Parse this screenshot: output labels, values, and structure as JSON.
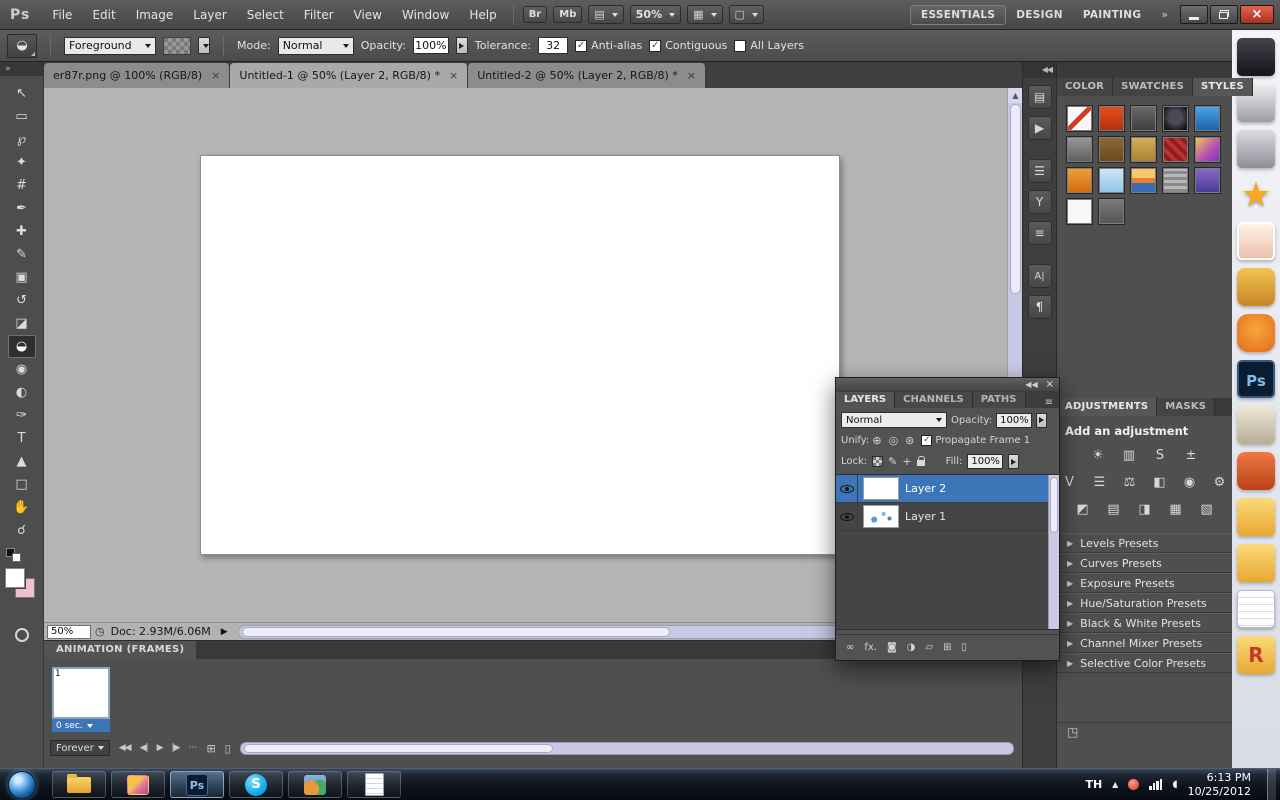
{
  "colors": {
    "selection_blue": "#3c76b9",
    "close_red": "#b03222",
    "scrollbar_lavender": "#c9c9e6",
    "canvas_gray": "#b5b5b5"
  },
  "menubar": {
    "logo": "Ps",
    "menus": [
      "File",
      "Edit",
      "Image",
      "Layer",
      "Select",
      "Filter",
      "View",
      "Window",
      "Help"
    ],
    "bridge": "Br",
    "mini_bridge": "Mb",
    "zoom": "50%",
    "view_extras_glyph": "▤",
    "arrange_glyph": "▦",
    "screen_mode_glyph": "▢",
    "workspaces": [
      "ESSENTIALS",
      "DESIGN",
      "PAINTING"
    ],
    "overflow": "»"
  },
  "options": {
    "tool_glyph": "◒",
    "fill": "Foreground",
    "mode_label": "Mode:",
    "mode": "Normal",
    "opacity_label": "Opacity:",
    "opacity": "100%",
    "tolerance_label": "Tolerance:",
    "tolerance": "32",
    "check": "✓",
    "anti_alias": "Anti-alias",
    "contiguous": "Contiguous",
    "all_layers": "All Layers"
  },
  "tabs": [
    {
      "title": "er87r.png @ 100% (RGB/8)",
      "close": "×"
    },
    {
      "title": "Untitled-1 @ 50% (Layer 2, RGB/8) *",
      "close": "×"
    },
    {
      "title": "Untitled-2 @ 50% (Layer 2, RGB/8) *",
      "close": "×"
    }
  ],
  "toolstrip": {
    "collapse": "»"
  },
  "tools": [
    {
      "name": "move-tool",
      "glyph": "↖"
    },
    {
      "name": "rectangular-marquee-tool",
      "glyph": "▭"
    },
    {
      "name": "lasso-tool",
      "glyph": "℘"
    },
    {
      "name": "quick-selection-tool",
      "glyph": "✦"
    },
    {
      "name": "crop-tool",
      "glyph": "#"
    },
    {
      "name": "eyedropper-tool",
      "glyph": "✒"
    },
    {
      "name": "spot-healing-brush-tool",
      "glyph": "✚"
    },
    {
      "name": "brush-tool",
      "glyph": "✎"
    },
    {
      "name": "clone-stamp-tool",
      "glyph": "▣"
    },
    {
      "name": "history-brush-tool",
      "glyph": "↺"
    },
    {
      "name": "eraser-tool",
      "glyph": "◪"
    },
    {
      "name": "paint-bucket-tool",
      "glyph": "◒"
    },
    {
      "name": "blur-tool",
      "glyph": "◉"
    },
    {
      "name": "dodge-tool",
      "glyph": "◐"
    },
    {
      "name": "pen-tool",
      "glyph": "✑"
    },
    {
      "name": "type-tool",
      "glyph": "T"
    },
    {
      "name": "path-selection-tool",
      "glyph": "▲"
    },
    {
      "name": "shape-tool",
      "glyph": "□"
    },
    {
      "name": "hand-tool",
      "glyph": "✋"
    },
    {
      "name": "zoom-tool",
      "glyph": "☌"
    }
  ],
  "dock": {
    "collapse": "◀◀",
    "icons": [
      {
        "name": "info-panel-icon",
        "glyph": "▤"
      },
      {
        "name": "actions-panel-icon",
        "glyph": "▶"
      },
      {
        "name": "adjust-panel-icon",
        "glyph": "☰"
      },
      {
        "name": "tool-presets-panel-icon",
        "glyph": "Y"
      },
      {
        "name": "layer-comps-panel-icon",
        "glyph": "≡"
      },
      {
        "name": "character-panel-icon",
        "glyph": "A|"
      },
      {
        "name": "paragraph-panel-icon",
        "glyph": "¶"
      }
    ]
  },
  "styles": {
    "tabs": [
      "COLOR",
      "SWATCHES",
      "STYLES"
    ],
    "swatches": [
      {
        "css": "background:linear-gradient(135deg,#f8f8f8 43%,#d43c2a 43%,#d43c2a 57%,#f8f8f8 57%)"
      },
      {
        "css": "background:linear-gradient(#e84e1b,#b33010)"
      },
      {
        "css": "background:linear-gradient(#6a6a6a,#3d3d3d)"
      },
      {
        "css": "background:radial-gradient(circle at 50% 45%,#4a4a55 0 35%,#16161c 75%)"
      },
      {
        "css": "background:linear-gradient(#4aa7e8,#1b5fa8)"
      },
      {
        "css": "background:linear-gradient(#9a9a9a,#5c5c5c)"
      },
      {
        "css": "background:linear-gradient(#8a6a32,#6a4a1f)"
      },
      {
        "css": "background:linear-gradient(#d8b05c,#a8802f)"
      },
      {
        "css": "background:repeating-linear-gradient(45deg,#c03030 0 4px,#8a1f1f 4px 8px)"
      },
      {
        "css": "background:linear-gradient(135deg,#e8d24a,#b84ab8 60%,#6a3ab0)"
      },
      {
        "css": "background:linear-gradient(#f0a03a,#d06a10)"
      },
      {
        "css": "background:linear-gradient(#cfe8f8,#8fc4e8)"
      },
      {
        "css": "background:linear-gradient(#f8c86a 0 40%,#e88030 40% 60%,#3a6ab0 60%)"
      },
      {
        "css": "background:repeating-linear-gradient(#b8b8b8 0 3px,#8a8a8a 3px 6px)"
      },
      {
        "css": "background:linear-gradient(#8a6ac8,#4a3a90)"
      },
      {
        "css": "background:#f8f8f8"
      },
      {
        "css": "background:linear-gradient(#7a7a7a,#555)"
      }
    ]
  },
  "adjustments": {
    "tab_a": "ADJUSTMENTS",
    "tab_b": "MASKS",
    "heading": "Add an adjustment",
    "row1": [
      "☀",
      "▥",
      "S",
      "±"
    ],
    "row2": [
      "V",
      "☰",
      "⚖",
      "◧",
      "◉",
      "⚙"
    ],
    "row3": [
      "◩",
      "▤",
      "◨",
      "▦",
      "▧"
    ],
    "expand": "▶",
    "presets": [
      "Levels Presets",
      "Curves Presets",
      "Exposure Presets",
      "Hue/Saturation Presets",
      "Black & White Presets",
      "Channel Mixer Presets",
      "Selective Color Presets"
    ],
    "footer_glyph": "◳"
  },
  "layers_panel": {
    "collapse": "◀◀",
    "close": "×",
    "menu": "≡",
    "tabs": [
      "LAYERS",
      "CHANNELS",
      "PATHS"
    ],
    "blend": "Normal",
    "opacity_label": "Opacity:",
    "opacity": "100%",
    "unify_label": "Unify:",
    "unify_icons": [
      "⊕",
      "◎",
      "⊛"
    ],
    "check": "✓",
    "propagate": "Propagate Frame 1",
    "lock_label": "Lock:",
    "brush_glyph": "✎",
    "move_glyph": "+",
    "fill_label": "Fill:",
    "fill": "100%",
    "layers": [
      {
        "name": "Layer 2"
      },
      {
        "name": "Layer 1"
      }
    ],
    "bottom_icons": [
      {
        "name": "link-layers-icon",
        "glyph": "∞"
      },
      {
        "name": "layer-effects-icon",
        "glyph": "fx."
      },
      {
        "name": "layer-mask-icon",
        "glyph": "◙"
      },
      {
        "name": "adjustment-layer-icon",
        "glyph": "◑"
      },
      {
        "name": "layer-group-icon",
        "glyph": "▱"
      },
      {
        "name": "new-layer-icon",
        "glyph": "⊞"
      },
      {
        "name": "delete-layer-icon",
        "glyph": "▯"
      }
    ]
  },
  "status": {
    "zoom": "50%",
    "timer_glyph": "◷",
    "doc": "Doc: 2.93M/6.06M",
    "arrow": "▶"
  },
  "animation": {
    "title": "ANIMATION (FRAMES)",
    "frame_number": "1",
    "delay": "0 sec.",
    "loop": "Forever",
    "transport": [
      {
        "name": "first-frame-button",
        "glyph": "◀◀"
      },
      {
        "name": "previous-frame-button",
        "glyph": "◀|"
      },
      {
        "name": "play-animation-button",
        "glyph": "▶"
      },
      {
        "name": "next-frame-button",
        "glyph": "|▶"
      }
    ],
    "tween_glyph": "⋯",
    "duplicate_glyph": "⊞",
    "delete_glyph": "▯"
  },
  "desktop": {
    "icons": [
      {
        "name": "desktop-image-anime-1",
        "label": "",
        "css": "background:linear-gradient(#44444e,#15151c)"
      },
      {
        "name": "desktop-image-anime-2",
        "label": "",
        "css": "background:linear-gradient(#f0f0f2,#9d9da8)"
      },
      {
        "name": "desktop-image-anime-3",
        "label": "",
        "css": "background:linear-gradient(#dcdce2,#8e8e9a)"
      },
      {
        "name": "desktop-icon-star-mascot",
        "label": "★",
        "css": "background:transparent;box-shadow:none;color:#f6a81f;font-size:34px;text-shadow:0 2px 3px rgba(0,0,0,.35)"
      },
      {
        "name": "desktop-icon-photos",
        "label": "",
        "css": "background:linear-gradient(#fdf3e4,#ecbfae);border:2px solid #fff"
      },
      {
        "name": "desktop-icon-satchel",
        "label": "",
        "css": "background:linear-gradient(#f3c44d,#c8862b);border-radius:8px"
      },
      {
        "name": "desktop-icon-fox-mascot",
        "label": "",
        "css": "background:radial-gradient(circle at 50% 40%,#f9a63c,#e06d1b);border-radius:11px"
      },
      {
        "name": "desktop-icon-photoshop",
        "label": "Ps",
        "css": "background:#0b1c30;border:2px solid #335a83;color:#7fbbe8;font-weight:bold;font-size:15px"
      },
      {
        "name": "desktop-icon-camera",
        "label": "",
        "css": "background:linear-gradient(#efe7d7,#b7ae97);border-radius:6px"
      },
      {
        "name": "desktop-icon-satchel-red",
        "label": "",
        "css": "background:linear-gradient(#ee7a43,#bc4019);border-radius:8px"
      },
      {
        "name": "desktop-icon-folder-1",
        "label": "",
        "css": "background:linear-gradient(#fada78,#e8a832)"
      },
      {
        "name": "desktop-icon-folder-2",
        "label": "",
        "css": "background:linear-gradient(#fada78,#e8a832)"
      },
      {
        "name": "desktop-icon-notepad",
        "label": "",
        "css": "background:repeating-linear-gradient(#ffffff 0 6px,#d9dde8 6px 7px);border:1px solid #b8bcc8"
      },
      {
        "name": "desktop-icon-r-folder",
        "label": "R",
        "css": "background:linear-gradient(#fada78,#e8a832);color:#c23b2a;font-weight:bold;font-size:20px"
      }
    ]
  },
  "taskbar": {
    "language": "TH",
    "tray_expand": "▲",
    "ps_label": "Ps",
    "skype_label": "S",
    "time": "6:13 PM",
    "date": "10/25/2012"
  }
}
